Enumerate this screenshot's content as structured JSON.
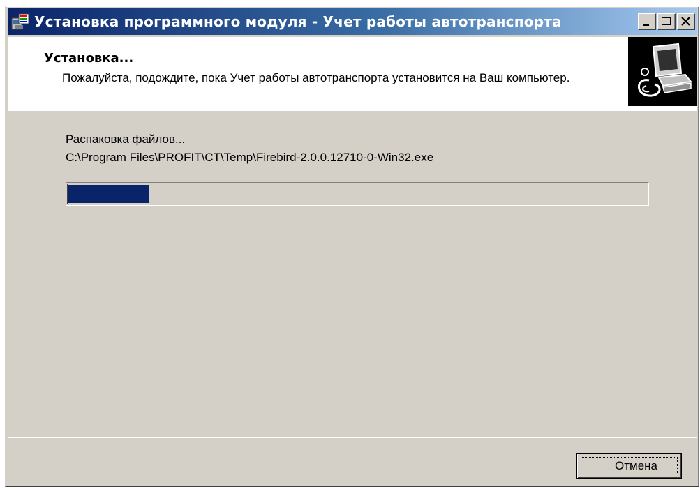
{
  "window": {
    "title": "Установка программного модуля - Учет работы автотранспорта",
    "controls": [
      "minimize-icon",
      "maximize-icon",
      "close-icon"
    ]
  },
  "header": {
    "title": "Установка...",
    "description": "Пожалуйста, подождите, пока Учет работы автотранспорта установится на Ваш компьютер.",
    "logo_icon": "computer-install-icon"
  },
  "status": {
    "label": "Распаковка файлов...",
    "current_file": "C:\\Program Files\\PROFIT\\CT\\Temp\\Firebird-2.0.0.12710-0-Win32.exe"
  },
  "progress": {
    "fraction": 0.14,
    "color": "#0a246a"
  },
  "buttons": {
    "cancel_label": "Отмена"
  },
  "colors": {
    "title_gradient_start": "#0a246a",
    "title_gradient_end": "#a6caf0",
    "face": "#d4d0c8"
  }
}
